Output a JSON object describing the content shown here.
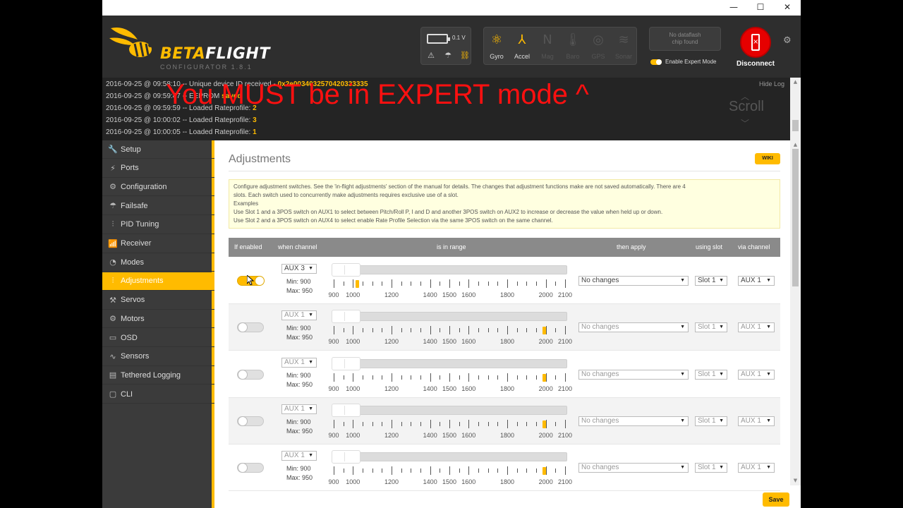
{
  "window": {
    "minimize": "—",
    "maximize": "☐",
    "close": "✕"
  },
  "header": {
    "logo_prefix": "BETA",
    "logo_suffix": "FLIGHT",
    "logo_sub": "CONFIGURATOR  1.8.1",
    "battery_voltage": "0.1 V",
    "sensors": [
      {
        "label": "Gyro",
        "icon": "gyro-icon",
        "glyph": "⚛",
        "active": true
      },
      {
        "label": "Accel",
        "icon": "accel-icon",
        "glyph": "⅄",
        "active": true
      },
      {
        "label": "Mag",
        "icon": "mag-icon",
        "glyph": "N",
        "active": false
      },
      {
        "label": "Baro",
        "icon": "baro-icon",
        "glyph": "🌡",
        "active": false
      },
      {
        "label": "GPS",
        "icon": "gps-icon",
        "glyph": "◎",
        "active": false
      },
      {
        "label": "Sonar",
        "icon": "sonar-icon",
        "glyph": "≋",
        "active": false
      }
    ],
    "dataflash_line1": "No dataflash",
    "dataflash_line2": "chip found",
    "expert_mode_label": "Enable Expert Mode",
    "disconnect_label": "Disconnect",
    "accent_color": "#ffbb00",
    "disconnect_color": "#e60000"
  },
  "log": {
    "hide_label": "Hide Log",
    "scroll_label": "Scroll",
    "overlay": "You MUST be in EXPERT mode  ^",
    "lines": [
      {
        "text": "2016-09-25 @ 09:58:10 -- Unique device ID received - ",
        "value": "0x2e0034032570420333335"
      },
      {
        "text": "2016-09-25 @ 09:59:47 -- EEPROM ",
        "value": "saved"
      },
      {
        "text": "2016-09-25 @ 09:59:59 -- Loaded Rateprofile: ",
        "value": "2"
      },
      {
        "text": "2016-09-25 @ 10:00:02 -- Loaded Rateprofile: ",
        "value": "3"
      },
      {
        "text": "2016-09-25 @ 10:00:05 -- Loaded Rateprofile: ",
        "value": "1"
      }
    ]
  },
  "sidebar": {
    "items": [
      {
        "label": "Setup",
        "icon": "wrench-icon",
        "glyph": "🔧"
      },
      {
        "label": "Ports",
        "icon": "plug-icon",
        "glyph": "⚡"
      },
      {
        "label": "Configuration",
        "icon": "gear-icon",
        "glyph": "⚙"
      },
      {
        "label": "Failsafe",
        "icon": "parachute-icon",
        "glyph": "☂"
      },
      {
        "label": "PID Tuning",
        "icon": "sliders-icon",
        "glyph": "⫶"
      },
      {
        "label": "Receiver",
        "icon": "receiver-icon",
        "glyph": "📶"
      },
      {
        "label": "Modes",
        "icon": "modes-icon",
        "glyph": "◔"
      },
      {
        "label": "Adjustments",
        "icon": "adjustments-icon",
        "glyph": "⫶",
        "active": true
      },
      {
        "label": "Servos",
        "icon": "servo-icon",
        "glyph": "⚒"
      },
      {
        "label": "Motors",
        "icon": "motor-icon",
        "glyph": "⚙"
      },
      {
        "label": "OSD",
        "icon": "osd-icon",
        "glyph": "▭"
      },
      {
        "label": "Sensors",
        "icon": "sensors-icon",
        "glyph": "∿"
      },
      {
        "label": "Tethered Logging",
        "icon": "logging-icon",
        "glyph": "▤"
      },
      {
        "label": "CLI",
        "icon": "cli-icon",
        "glyph": "▢"
      }
    ]
  },
  "content": {
    "title": "Adjustments",
    "wiki_label": "WIKI",
    "note_lines": [
      "Configure adjustment switches. See the 'in-flight adjustments' section of the manual for details. The changes that adjustment functions make are not saved automatically. There are 4",
      "slots. Each switch used to concurrently make adjustments requires exclusive use of a slot.",
      "Examples",
      "Use Slot 1 and a 3POS switch on AUX1 to select between Pitch/Roll P, I and D and another 3POS switch on AUX2 to increase or decrease the value when held up or down.",
      "Use Slot 2 and a 3POS switch on AUX4 to select enable Rate Profile Selection via the same 3POS switch on the same channel."
    ],
    "headers": {
      "enabled": "If enabled",
      "channel": "when channel",
      "range": "is in range",
      "apply": "then apply",
      "slot": "using slot",
      "via": "via channel"
    },
    "tick_labels": [
      "900",
      "1000",
      "1200",
      "1400",
      "1500",
      "1600",
      "1800",
      "2000",
      "2100"
    ],
    "range_min": 900,
    "range_max": 2100,
    "rows": [
      {
        "enabled": true,
        "channel": "AUX 3",
        "min": "Min: 900",
        "max": "Max: 950",
        "apply": "No changes",
        "slot": "Slot 1",
        "via": "AUX 1",
        "marker": 1020
      },
      {
        "enabled": false,
        "channel": "AUX 1",
        "min": "Min: 900",
        "max": "Max: 950",
        "apply": "No changes",
        "slot": "Slot 1",
        "via": "AUX 1",
        "marker": 1990
      },
      {
        "enabled": false,
        "channel": "AUX 1",
        "min": "Min: 900",
        "max": "Max: 950",
        "apply": "No changes",
        "slot": "Slot 1",
        "via": "AUX 1",
        "marker": 1990
      },
      {
        "enabled": false,
        "channel": "AUX 1",
        "min": "Min: 900",
        "max": "Max: 950",
        "apply": "No changes",
        "slot": "Slot 1",
        "via": "AUX 1",
        "marker": 1990
      },
      {
        "enabled": false,
        "channel": "AUX 1",
        "min": "Min: 900",
        "max": "Max: 950",
        "apply": "No changes",
        "slot": "Slot 1",
        "via": "AUX 1",
        "marker": 1990
      }
    ],
    "save_label": "Save"
  }
}
